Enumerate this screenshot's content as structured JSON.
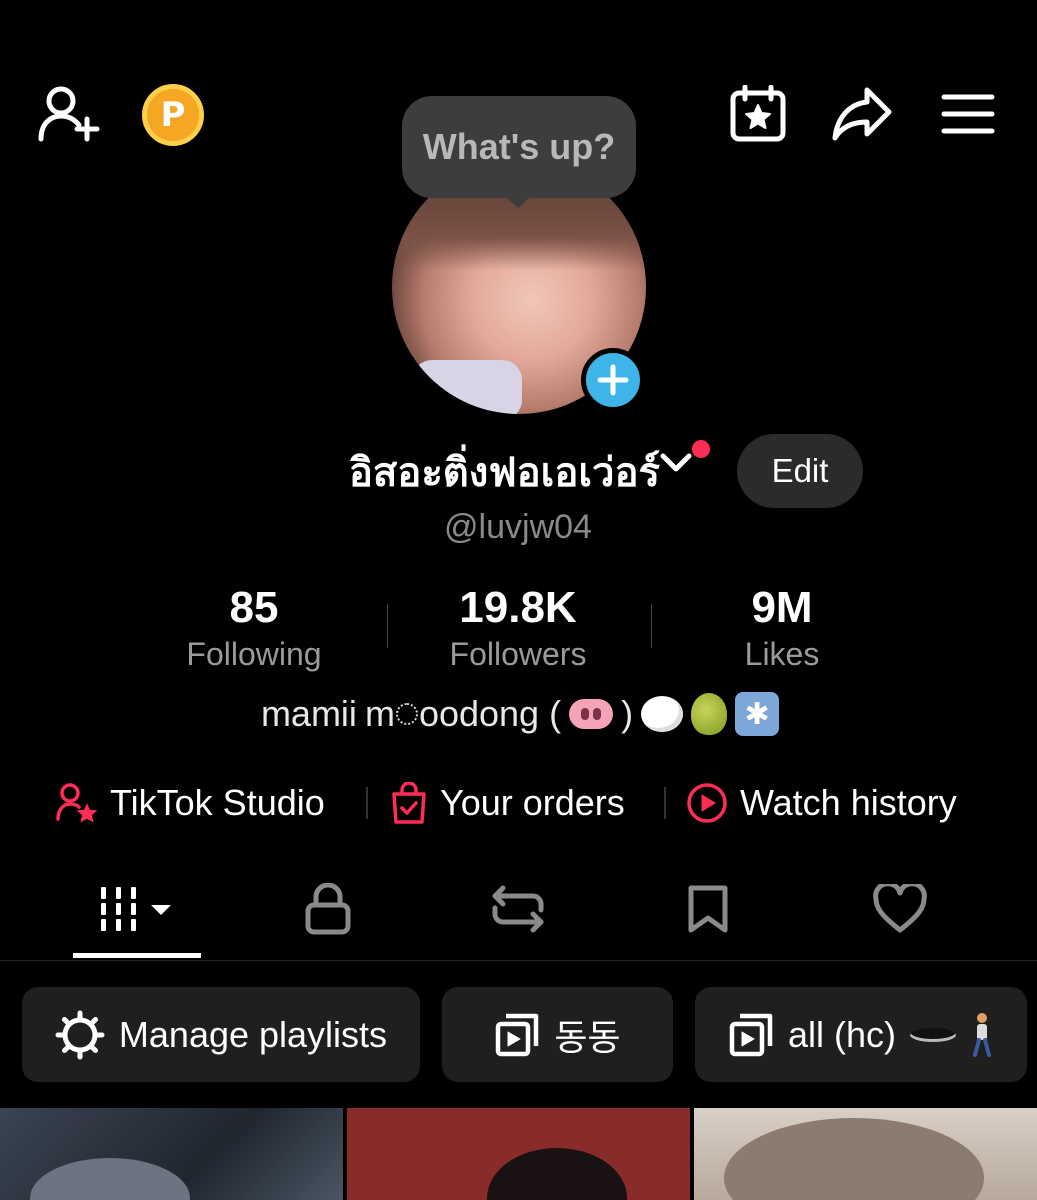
{
  "bubble": {
    "text": "What's up?"
  },
  "profile": {
    "display_name": "อิสอะติ่งฟอเอเว่อร์",
    "handle": "@luvjw04",
    "edit_label": "Edit",
    "coin_letter": "P"
  },
  "stats": [
    {
      "value": "85",
      "label": "Following"
    },
    {
      "value": "19.8K",
      "label": "Followers"
    },
    {
      "value": "9M",
      "label": "Likes"
    }
  ],
  "bio": {
    "text_a": "mamii",
    "text_b": "m",
    "text_c": "oodong (",
    "text_d": ")",
    "emojis": [
      "pig-nose",
      "thought-balloon",
      "pear",
      "snowflake-button"
    ]
  },
  "links": [
    {
      "label": "TikTok Studio",
      "icon": "user-star-icon"
    },
    {
      "label": "Your orders",
      "icon": "shopping-bag-icon"
    },
    {
      "label": "Watch history",
      "icon": "play-circle-icon"
    }
  ],
  "tabs": [
    {
      "name": "videos",
      "icon": "grid-icon",
      "active": true
    },
    {
      "name": "private",
      "icon": "lock-icon"
    },
    {
      "name": "reposts",
      "icon": "repost-icon"
    },
    {
      "name": "favorites",
      "icon": "bookmark-icon"
    },
    {
      "name": "liked",
      "icon": "heart-icon"
    }
  ],
  "playlists": [
    {
      "label": "Manage playlists",
      "icon": "gear-icon"
    },
    {
      "label": "동동",
      "icon": "playlist-icon"
    },
    {
      "label": "all (hc)",
      "icon": "playlist-icon",
      "suffix_emojis": [
        "hole",
        "walking-person"
      ]
    }
  ],
  "colors": {
    "accent_red": "#ff2c55",
    "accent_blue": "#3fb4e8",
    "coin": "#f5a623"
  }
}
